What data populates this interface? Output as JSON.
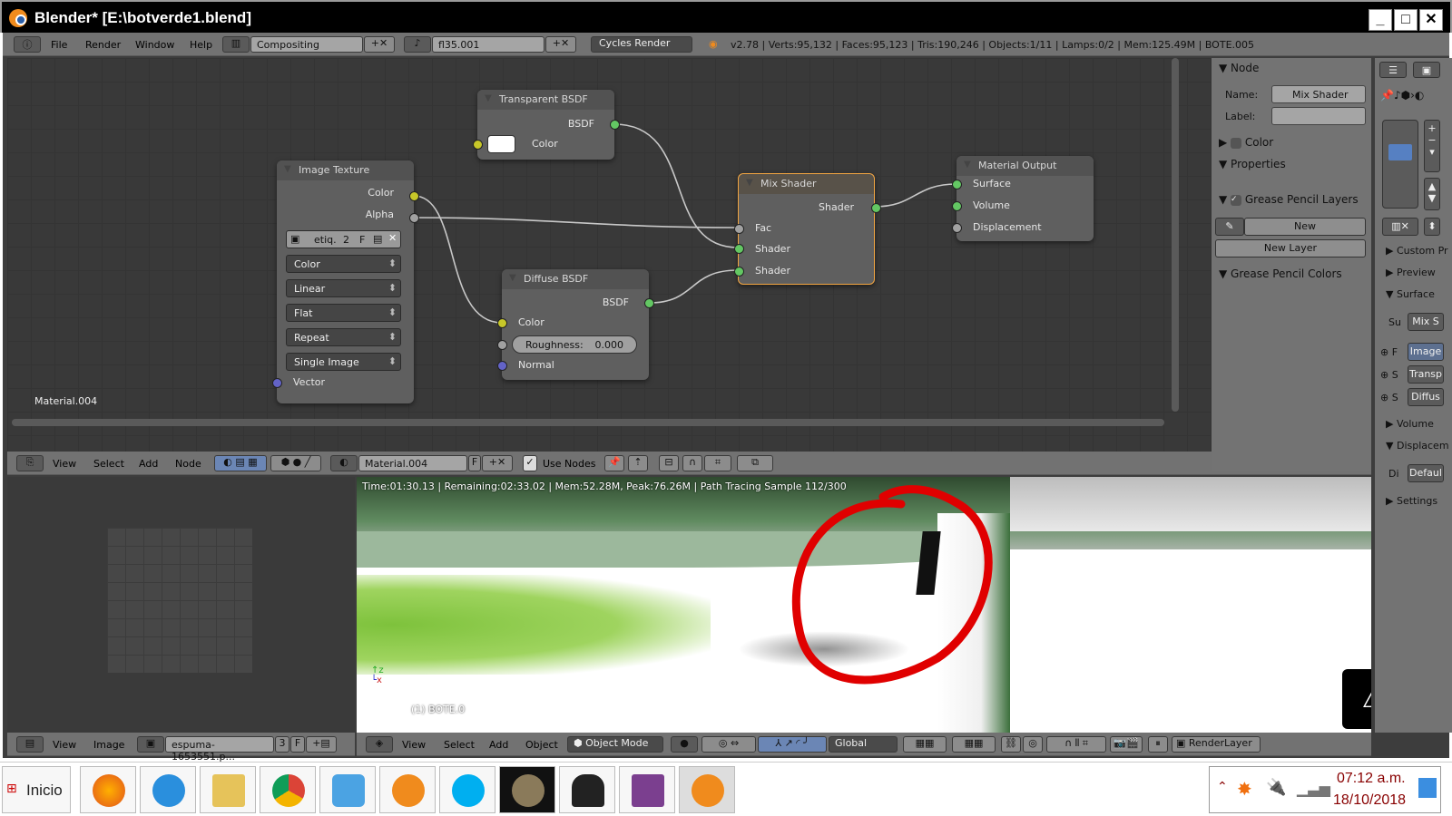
{
  "window": {
    "title": "Blender* [E:\\botverde1.blend]",
    "min": "_",
    "max": "□",
    "close": "✕"
  },
  "top_header": {
    "menus": [
      "File",
      "Render",
      "Window",
      "Help"
    ],
    "screen": "Compositing",
    "scene": "fl35.001",
    "engine": "Cycles Render",
    "stats": "v2.78 | Verts:95,132 | Faces:95,123 | Tris:190,246 | Objects:1/11 | Lamps:0/2 | Mem:125.49M | BOTE.005"
  },
  "nodes": {
    "image_texture": {
      "title": "Image Texture",
      "outputs": [
        "Color",
        "Alpha"
      ],
      "image": "etiq.",
      "users": "2",
      "fake": "F",
      "color_space": "Color",
      "interpolation": "Linear",
      "projection": "Flat",
      "extension": "Repeat",
      "source": "Single Image",
      "input": "Vector"
    },
    "transparent": {
      "title": "Transparent BSDF",
      "output": "BSDF",
      "input": "Color"
    },
    "diffuse": {
      "title": "Diffuse BSDF",
      "output": "BSDF",
      "inputs": [
        "Color",
        "Normal"
      ],
      "roughness_label": "Roughness:",
      "roughness": "0.000"
    },
    "mix": {
      "title": "Mix Shader",
      "output": "Shader",
      "inputs": [
        "Fac",
        "Shader",
        "Shader"
      ]
    },
    "output": {
      "title": "Material Output",
      "inputs": [
        "Surface",
        "Volume",
        "Displacement"
      ]
    }
  },
  "node_editor": {
    "material_label": "Material.004",
    "menus": [
      "View",
      "Select",
      "Add",
      "Node"
    ],
    "material": "Material.004",
    "fake": "F",
    "use_nodes": "Use Nodes"
  },
  "n_panel": {
    "node_header": "Node",
    "name_label": "Name:",
    "name": "Mix Shader",
    "label_label": "Label:",
    "color": "Color",
    "properties": "Properties",
    "gp_layers": "Grease Pencil Layers",
    "new": "New",
    "new_layer": "New Layer",
    "gp_colors": "Grease Pencil Colors"
  },
  "material_panel": {
    "sections": [
      "Custom Pr",
      "Preview",
      "Surface",
      "Volume",
      "Displacem",
      "Settings"
    ],
    "surface_label": "Su",
    "surface_val": "Mix S",
    "rows": [
      {
        "l": "F",
        "v": "Image"
      },
      {
        "l": "S",
        "v": "Transp"
      },
      {
        "l": "S",
        "v": "Diffus"
      }
    ],
    "disp_label": "Di",
    "disp_val": "Defaul"
  },
  "render": {
    "status": "Time:01:30.13 | Remaining:02:33.02 | Mem:52.28M, Peak:76.26M | Path Tracing Sample 112/300",
    "object": "(1) BOTE.0"
  },
  "image_editor_header": {
    "menus": [
      "View",
      "Image"
    ],
    "image": "espuma-1653551.p...",
    "users": "3",
    "fake": "F"
  },
  "view3d_header": {
    "menus": [
      "View",
      "Select",
      "Add",
      "Object"
    ],
    "mode": "Object Mode",
    "orientation": "Global",
    "render_layer": "RenderLayer"
  },
  "taskbar": {
    "start": "Inicio",
    "time": "07:12 a.m.",
    "date": "18/10/2018",
    "apps": [
      "Firefox",
      "Internet Explorer",
      "File Explorer",
      "Chrome",
      "Media Player",
      "Settings",
      "Skype",
      "GIMP",
      "Inkscape",
      "WinRAR",
      "Blender"
    ]
  },
  "colors": {
    "selected": "#f2a541",
    "socket_shader": "#63c763",
    "socket_color": "#c7c729",
    "annotation": "#e00000"
  }
}
